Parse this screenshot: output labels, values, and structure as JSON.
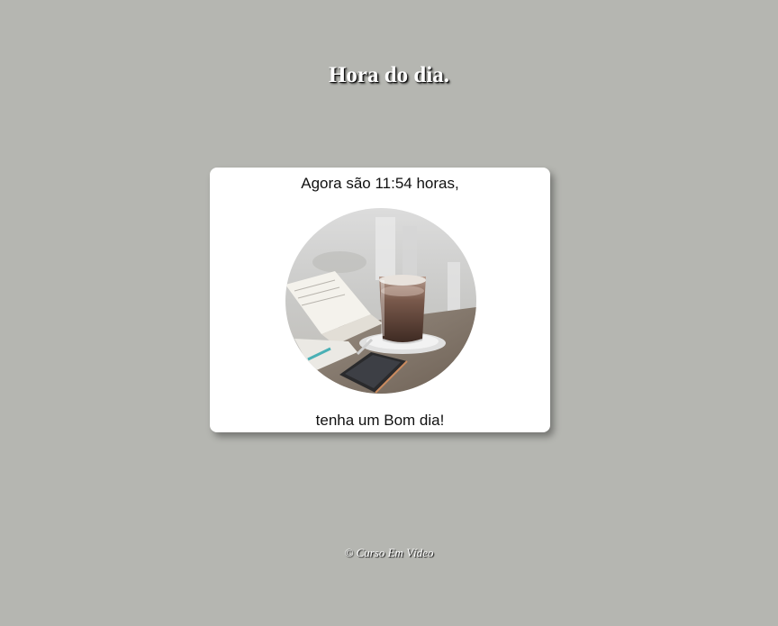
{
  "header": {
    "title": "Hora do dia."
  },
  "card": {
    "message_top": "Agora são 11:54 horas,",
    "message_bottom": "tenha um Bom dia!",
    "image_icon": "coffee-table-photo"
  },
  "footer": {
    "copyright": "© Curso Em Vídeo"
  },
  "colors": {
    "background": "#b5b6b1",
    "card": "#ffffff",
    "title_text": "#ffffff"
  }
}
